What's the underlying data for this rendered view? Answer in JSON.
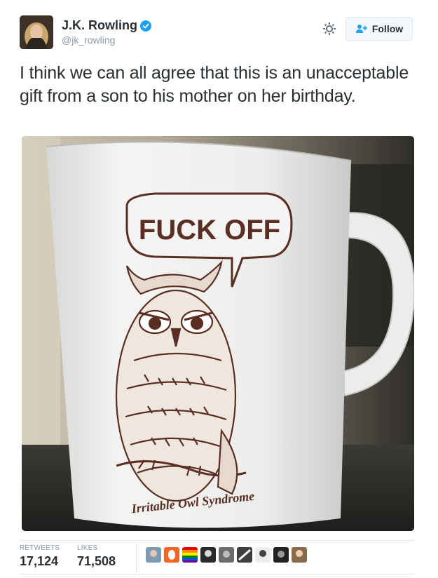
{
  "author": {
    "display_name": "J.K. Rowling",
    "handle": "@jk_rowling",
    "verified": true
  },
  "actions": {
    "follow_label": "Follow"
  },
  "tweet": {
    "text": "I think we can all agree that this is an unacceptable gift from a son to his mother on her birthday."
  },
  "media": {
    "speech_bubble_text": "FUCK OFF",
    "mug_caption": "Irritable Owl Syndrome"
  },
  "stats": {
    "retweets_label": "RETWEETS",
    "retweets_value": "17,124",
    "likes_label": "LIKES",
    "likes_value": "71,508"
  },
  "colors": {
    "text": "#292f33",
    "muted": "#8899a6",
    "verified": "#1da1f2",
    "border": "#e1e8ed",
    "owl_ink": "#5a2e22"
  }
}
